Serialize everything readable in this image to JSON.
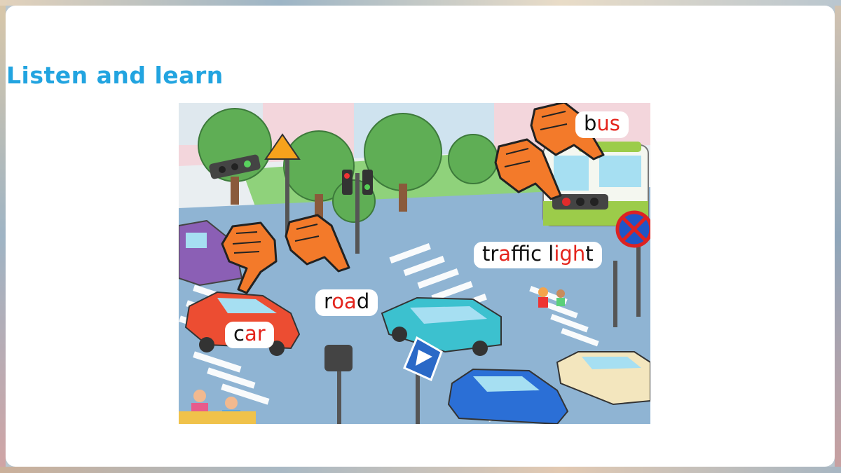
{
  "title": "Listen and learn",
  "labels": {
    "road": [
      "r",
      "oa",
      "d"
    ],
    "car": [
      "c",
      "ar"
    ],
    "bus": [
      "b",
      "us"
    ],
    "traffic_light": [
      "tr",
      "a",
      "ff",
      "i",
      "c l",
      "igh",
      "t"
    ]
  },
  "colors": {
    "title": "#22a4e0",
    "highlight": "#e4241c",
    "hand": "#f37a2a"
  },
  "icons": [
    "pointing-hand-icon",
    "traffic-light-icon",
    "pedestrian-crossing-sign-icon",
    "no-parking-sign-icon",
    "school-crossing-sign-icon"
  ]
}
